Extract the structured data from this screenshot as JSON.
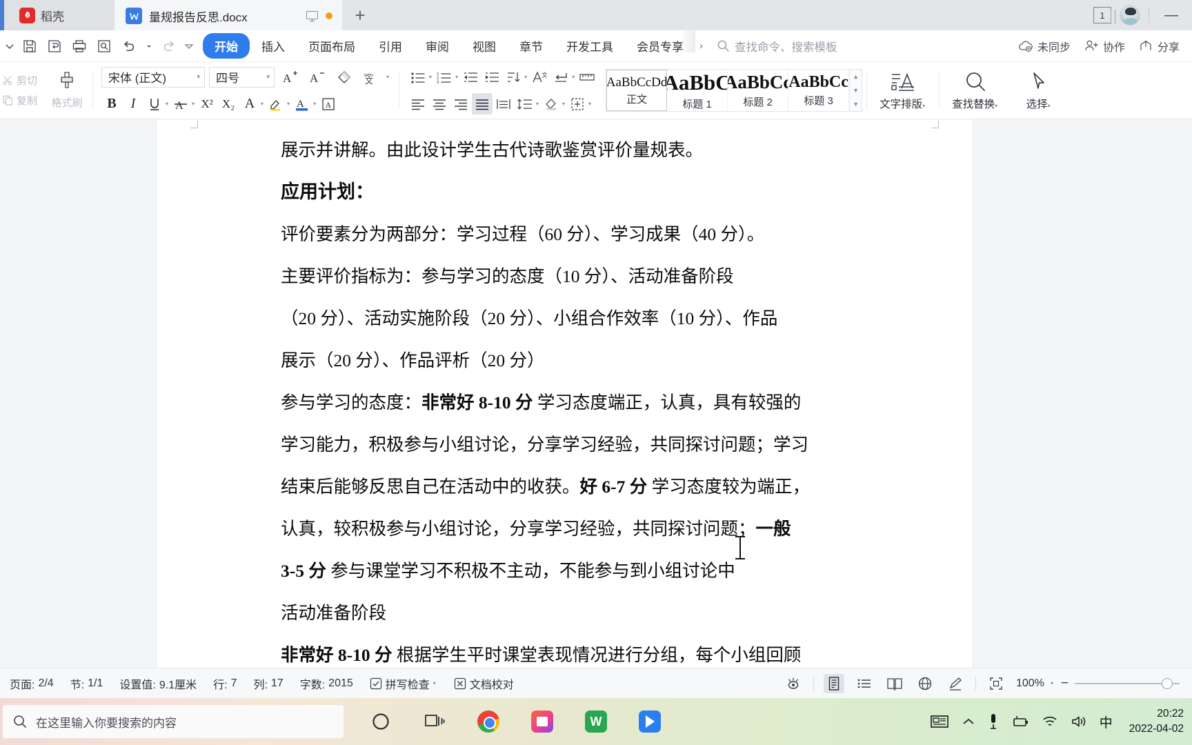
{
  "titlebar": {
    "docer_label": "稻壳",
    "docer_icon": "docer-logo-icon",
    "tab_icon_letter": "W",
    "tab_name": "量规报告反思.docx",
    "monitor_icon": "monitor-icon",
    "unsaved_dot": "unsaved-dot-icon",
    "new_tab_label": "+",
    "page_count": "1",
    "minimize_label": "—"
  },
  "quick_access": {
    "buttons": [
      {
        "name": "expand-ribbon-chevron-icon",
        "glyph": "⌄"
      },
      {
        "name": "save-icon",
        "glyph": "save"
      },
      {
        "name": "save-as-icon",
        "glyph": "saveas"
      },
      {
        "name": "print-icon",
        "glyph": "print"
      },
      {
        "name": "print-preview-icon",
        "glyph": "preview"
      },
      {
        "name": "undo-icon",
        "glyph": "undo"
      },
      {
        "name": "redo-icon",
        "glyph": "redo"
      },
      {
        "name": "customize-qat-icon",
        "glyph": "⌄"
      }
    ]
  },
  "ribbon": {
    "tabs": [
      {
        "label": "开始",
        "active": true
      },
      {
        "label": "插入",
        "active": false
      },
      {
        "label": "页面布局",
        "active": false
      },
      {
        "label": "引用",
        "active": false
      },
      {
        "label": "审阅",
        "active": false
      },
      {
        "label": "视图",
        "active": false
      },
      {
        "label": "章节",
        "active": false
      },
      {
        "label": "开发工具",
        "active": false
      },
      {
        "label": "会员专享",
        "active": false
      }
    ],
    "overflow_chevron": "›",
    "search_placeholder": "查找命令、搜索模板",
    "right_items": [
      {
        "label": "未同步",
        "icon": "cloud-sync-off-icon"
      },
      {
        "label": "协作",
        "icon": "add-user-icon"
      },
      {
        "label": "分享",
        "icon": "share-icon"
      }
    ]
  },
  "toolbar": {
    "cut_label": "剪切",
    "copy_label": "复制",
    "format_painter_label": "格式刷",
    "font_name": "宋体 (正文)",
    "font_size": "四号",
    "grow_font": "A+",
    "shrink_font": "A-",
    "clear_format_icon": "clear-format-icon",
    "pinyin_icon": "pinyin-guide-icon",
    "bold": "B",
    "italic": "I",
    "underline": "U",
    "strikethrough": "A",
    "superscript": "X²",
    "subscript": "X₂",
    "text_effects": "A",
    "highlight_icon": "highlight-color-icon",
    "font_color_icon": "font-color-icon",
    "char_border_icon": "character-border-icon",
    "paragraph_icons": [
      "bullet-list-icon",
      "numbered-list-icon",
      "multilevel-list-icon",
      "decrease-indent-icon",
      "increase-indent-icon",
      "sort-icon",
      "chinese-layout-icon",
      "line-break-icon",
      "ruler-icon",
      "align-left-icon",
      "align-center-icon",
      "align-right-icon",
      "justify-icon",
      "distribute-icon",
      "line-spacing-icon",
      "shading-icon",
      "borders-icon"
    ],
    "gallery": [
      {
        "preview": "AaBbCcDd",
        "label": "正文",
        "selected": true
      },
      {
        "preview": "AaBbC",
        "label": "标题 1",
        "selected": false
      },
      {
        "preview": "AaBbCc",
        "label": "标题 2",
        "selected": false
      },
      {
        "preview": "AaBbCc",
        "label": "标题 3",
        "selected": false
      }
    ],
    "typeset_label": "文字排版",
    "find_replace_label": "查找替换",
    "select_label": "选择"
  },
  "document": {
    "paragraphs": [
      {
        "text": "展示并讲解。由此设计学生古代诗歌鉴赏评价量规表。",
        "style": "body"
      },
      {
        "text": "应用计划：",
        "style": "heading"
      },
      {
        "text": "评价要素分为两部分：学习过程（60 分）、学习成果（40 分）。",
        "style": "body"
      },
      {
        "text": "主要评价指标为：参与学习的态度（10 分）、活动准备阶段",
        "style": "body"
      },
      {
        "text": "（20 分）、活动实施阶段（20 分）、小组合作效率（10 分）、作品",
        "style": "body"
      },
      {
        "text": "展示（20 分）、作品评析（20 分）",
        "style": "body"
      },
      {
        "text": "参与学习的态度：非常好 8-10 分 学习态度端正，认真，具有较强的",
        "style": "body",
        "bold_run": "非常好 8-10 分"
      },
      {
        "text": "学习能力，积极参与小组讨论，分享学习经验，共同探讨问题；学习",
        "style": "body"
      },
      {
        "text": "结束后能够反思自己在活动中的收获。好 6-7 分 学习态度较为端正，",
        "style": "body",
        "bold_run": "好 6-7 分"
      },
      {
        "text": " 认真，较积极参与小组讨论，分享学习经验，共同探讨问题；一般",
        "style": "body",
        "bold_run": "一般"
      },
      {
        "text": "3-5 分 参与课堂学习不积极不主动，不能参与到小组讨论中",
        "style": "body",
        "bold_run": "3-5 分"
      },
      {
        "text": "活动准备阶段",
        "style": "body"
      },
      {
        "text": "非常好 8-10 分 根据学生平时课堂表现情况进行分组，每个小组回顾",
        "style": "body",
        "bold_run": "非常好 8-10 分"
      }
    ]
  },
  "statusbar": {
    "page_label": "页面:",
    "page_value": "2/4",
    "section_label": "节:",
    "section_value": "1/1",
    "setting_label": "设置值:",
    "setting_value": "9.1厘米",
    "row_label": "行:",
    "row_value": "7",
    "col_label": "列:",
    "col_value": "17",
    "words_label": "字数:",
    "words_value": "2015",
    "spellcheck_label": "拼写检查",
    "proofread_label": "文档校对",
    "view_icons": [
      "eye-protection-icon",
      "page-view-icon",
      "outline-view-icon",
      "reading-view-icon",
      "web-view-icon",
      "edit-mode-icon",
      "fullscreen-icon"
    ],
    "zoom_value": "100%",
    "zoom_out": "−",
    "zoom_in": "+"
  },
  "taskbar": {
    "search_placeholder": "在这里输入你要搜索的内容",
    "search_icon": "search-icon",
    "apps": [
      {
        "name": "cortana-icon"
      },
      {
        "name": "task-view-icon"
      },
      {
        "name": "chrome-icon"
      },
      {
        "name": "wps-cloud-icon"
      },
      {
        "name": "wps-writer-icon"
      },
      {
        "name": "dingtalk-icon"
      }
    ],
    "tray": [
      {
        "name": "news-weather-icon"
      },
      {
        "name": "show-hidden-icons-chevron-icon"
      },
      {
        "name": "microphone-icon"
      },
      {
        "name": "battery-icon"
      },
      {
        "name": "wifi-icon"
      },
      {
        "name": "volume-icon"
      }
    ],
    "ime_label": "中",
    "time": "20:22",
    "date": "2022-04-02"
  },
  "colors": {
    "accent_blue": "#2f7deb",
    "docer_red": "#e02b28",
    "title_bg": "#e3e5e8"
  }
}
